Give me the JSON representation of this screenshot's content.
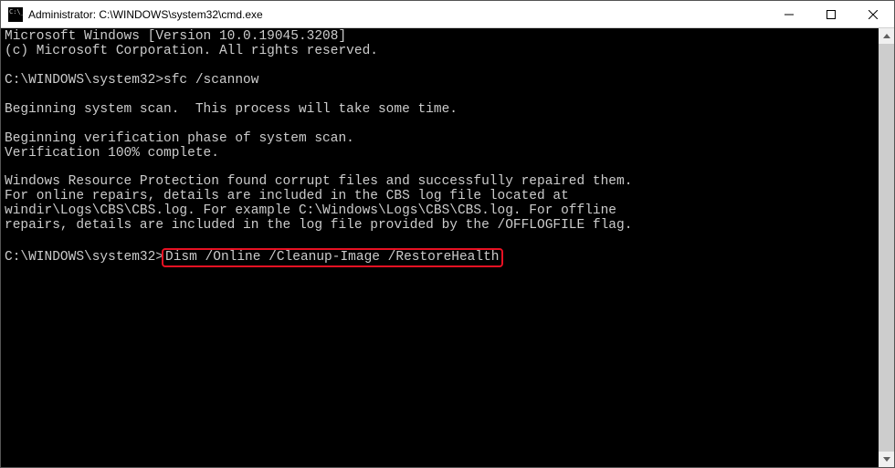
{
  "titlebar": {
    "title": "Administrator: C:\\WINDOWS\\system32\\cmd.exe"
  },
  "terminal": {
    "line1": "Microsoft Windows [Version 10.0.19045.3208]",
    "line2": "(c) Microsoft Corporation. All rights reserved.",
    "blank1": "",
    "prompt1_path": "C:\\WINDOWS\\system32>",
    "prompt1_cmd": "sfc /scannow",
    "blank2": "",
    "line3": "Beginning system scan.  This process will take some time.",
    "blank3": "",
    "line4": "Beginning verification phase of system scan.",
    "line5": "Verification 100% complete.",
    "blank4": "",
    "line6": "Windows Resource Protection found corrupt files and successfully repaired them.",
    "line7": "For online repairs, details are included in the CBS log file located at",
    "line8": "windir\\Logs\\CBS\\CBS.log. For example C:\\Windows\\Logs\\CBS\\CBS.log. For offline",
    "line9": "repairs, details are included in the log file provided by the /OFFLOGFILE flag.",
    "blank5": "",
    "prompt2_path": "C:\\WINDOWS\\system32>",
    "prompt2_cmd": "Dism /Online /Cleanup-Image /RestoreHealth"
  }
}
